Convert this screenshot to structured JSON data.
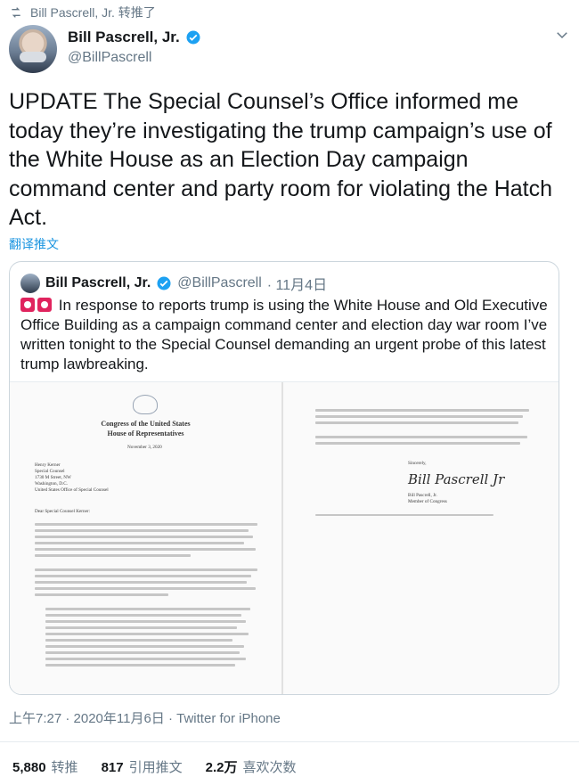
{
  "retweet": {
    "label": "Bill Pascrell, Jr. 转推了"
  },
  "author": {
    "name": "Bill Pascrell, Jr.",
    "handle": "@BillPascrell"
  },
  "tweet": {
    "text": "UPDATE The Special Counsel’s Office informed me today they’re investigating the trump campaign’s use of the White House as an Election Day campaign command center and party room for violating the Hatch Act."
  },
  "translate_label": "翻译推文",
  "quote": {
    "name": "Bill Pascrell, Jr.",
    "handle": "@BillPascrell",
    "date": "· 11月4日",
    "text": "In response to reports trump is using the White House and Old Executive Office Building as a campaign command center and election day war room I’ve written tonight to the Special Counsel demanding an urgent probe of this latest trump lawbreaking.",
    "document": {
      "letterhead_1": "Congress of the United States",
      "letterhead_2": "House of Representatives",
      "date_line": "November 3, 2020",
      "addressee": [
        "Henry Kerner",
        "Special Counsel",
        "1730 M Street, NW",
        "Washington, D.C.",
        "United States Office of Special Counsel"
      ],
      "salutation": "Dear Special Counsel Kerner:",
      "closing": "Sincerely,",
      "signature": "Bill Pascrell, Jr.",
      "signer": [
        "Bill Pascrell, Jr.",
        "Member of Congress"
      ]
    }
  },
  "meta": {
    "time": "上午7:27 · 2020年11月6日 · Twitter for iPhone"
  },
  "stats": [
    {
      "count": "5,880",
      "label": "转推"
    },
    {
      "count": "817",
      "label": "引用推文"
    },
    {
      "count": "2.2万",
      "label": "喜欢次数"
    }
  ],
  "colors": {
    "link": "#1b95e0",
    "muted": "#657786",
    "verified": "#1da1f2",
    "alarm": "#e0245e"
  }
}
